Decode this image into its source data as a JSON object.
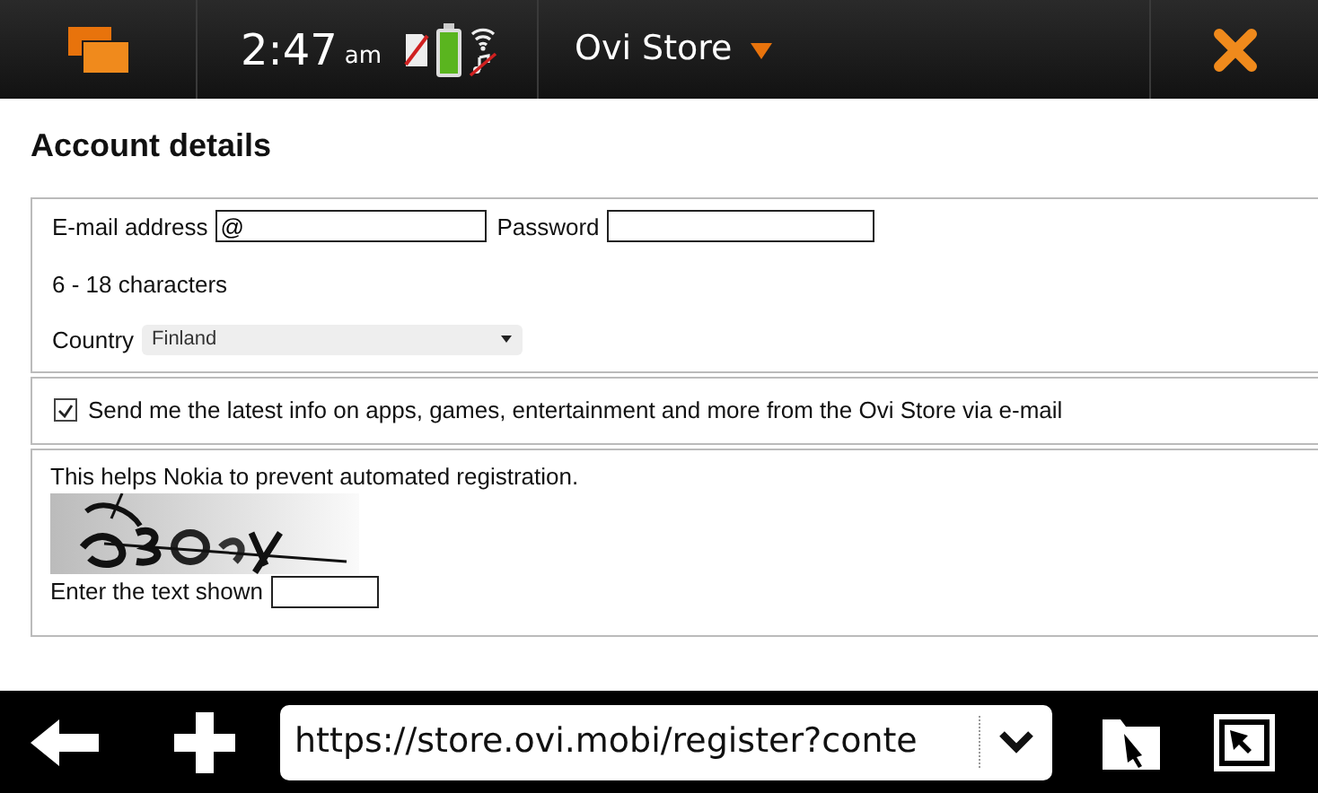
{
  "status_bar": {
    "time": "2:47",
    "period": "am",
    "title": "Ovi Store"
  },
  "heading": "Account details",
  "account": {
    "email_label": "E-mail address",
    "email_value": "@",
    "password_label": "Password",
    "password_hint": "6 - 18 characters",
    "country_label": "Country",
    "country_value": "Finland"
  },
  "newsletter": {
    "checked": true,
    "label": "Send me the latest info on apps, games, entertainment and more from the Ovi Store via e-mail"
  },
  "captcha": {
    "note": "This helps Nokia to prevent automated registration.",
    "prompt": "Enter the text shown"
  },
  "toolbar": {
    "url": "https://store.ovi.mobi/register?conte"
  }
}
